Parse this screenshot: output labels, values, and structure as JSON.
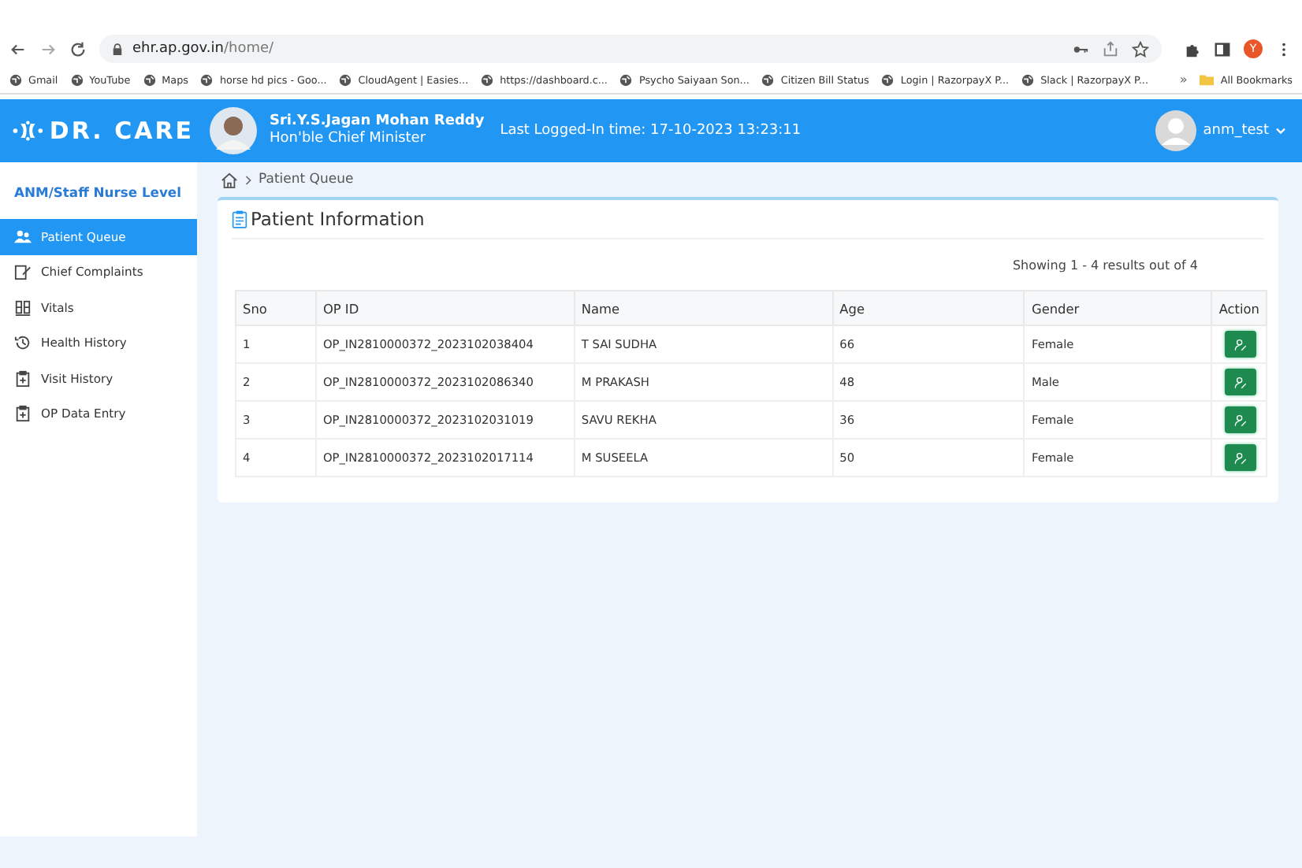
{
  "browser": {
    "url_host": "ehr.ap.gov.in",
    "url_path": "/home/",
    "profile_initial": "Y",
    "bookmarks": [
      "Gmail",
      "YouTube",
      "Maps",
      "horse hd pics - Goo...",
      "CloudAgent | Easies...",
      "https://dashboard.c...",
      "Psycho Saiyaan Son...",
      "Citizen Bill Status",
      "Login | RazorpayX P...",
      "Slack | RazorpayX P..."
    ],
    "overflow": "»",
    "all_bookmarks": "All Bookmarks"
  },
  "header": {
    "logo": "DR. CARE",
    "person_name": "Sri.Y.S.Jagan Mohan Reddy",
    "person_role": "Hon'ble Chief Minister",
    "last_login": "Last Logged-In time: 17-10-2023 13:23:11",
    "user": "anm_test"
  },
  "sidebar": {
    "title": "ANM/Staff Nurse Level",
    "items": [
      {
        "label": "Patient Queue",
        "kind": "people",
        "selected": true
      },
      {
        "label": "Chief Complaints",
        "kind": "note",
        "selected": false
      },
      {
        "label": "Vitals",
        "kind": "vitals",
        "selected": false
      },
      {
        "label": "Health History",
        "kind": "history",
        "selected": false
      },
      {
        "label": "Visit History",
        "kind": "clipboard",
        "selected": false
      },
      {
        "label": "OP Data Entry",
        "kind": "clipboard",
        "selected": false
      }
    ]
  },
  "breadcrumb": {
    "current": "Patient Queue"
  },
  "panel": {
    "title": "Patient Information",
    "summary": "Showing 1 - 4 results out of 4",
    "columns": [
      "Sno",
      "OP ID",
      "Name",
      "Age",
      "Gender",
      "Action"
    ],
    "rows": [
      [
        "1",
        "OP_IN2810000372_2023102038404",
        "T SAI SUDHA",
        "66",
        "Female"
      ],
      [
        "2",
        "OP_IN2810000372_2023102086340",
        "M PRAKASH",
        "48",
        "Male"
      ],
      [
        "3",
        "OP_IN2810000372_2023102031019",
        "SAVU REKHA",
        "36",
        "Female"
      ],
      [
        "4",
        "OP_IN2810000372_2023102017114",
        "M SUSEELA",
        "50",
        "Female"
      ]
    ]
  }
}
